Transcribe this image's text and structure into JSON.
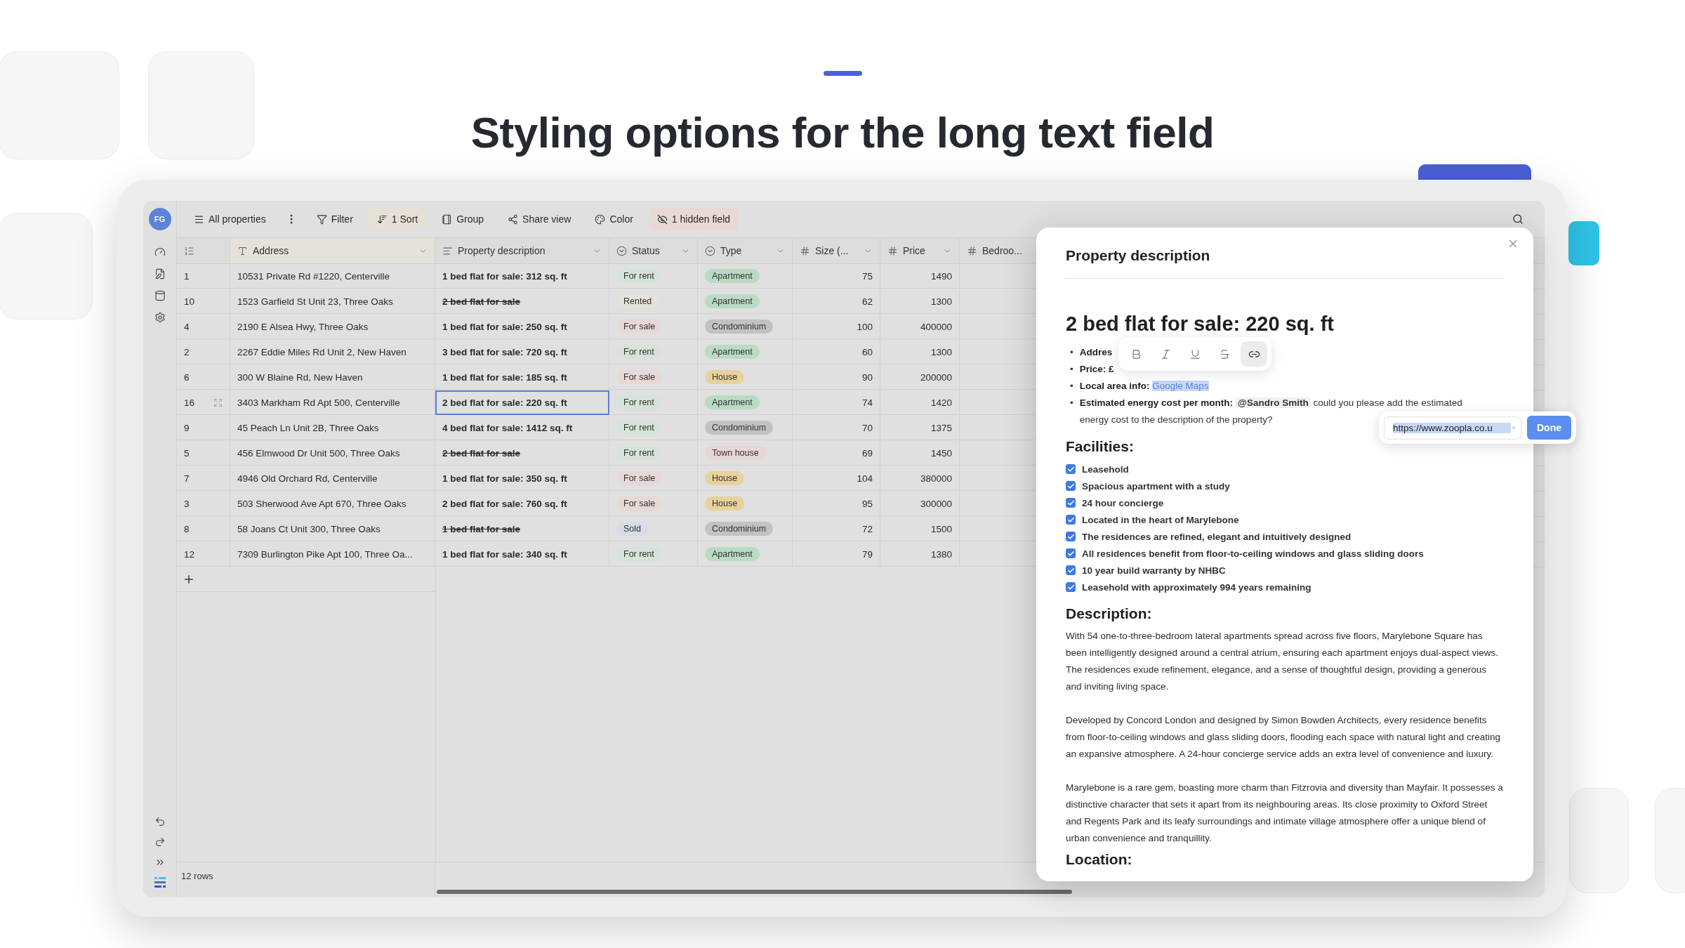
{
  "heading": "Styling options for the long text field",
  "app": {
    "avatar": "FG",
    "toolbar": [
      {
        "kind": "view",
        "label": "All properties"
      },
      {
        "kind": "more"
      },
      {
        "kind": "filter",
        "label": "Filter"
      },
      {
        "kind": "sort",
        "label": "1 Sort",
        "color": "#e6e1d6"
      },
      {
        "kind": "group",
        "label": "Group"
      },
      {
        "kind": "share",
        "label": "Share view"
      },
      {
        "kind": "color",
        "label": "Color"
      },
      {
        "kind": "hidden",
        "label": "1 hidden field",
        "color": "#e8d9d7"
      }
    ],
    "columns": [
      {
        "kind": "text",
        "label": "Address"
      },
      {
        "kind": "longtext",
        "label": "Property description"
      },
      {
        "kind": "select",
        "label": "Status"
      },
      {
        "kind": "select",
        "label": "Type"
      },
      {
        "kind": "number",
        "label": "Size (..."
      },
      {
        "kind": "number",
        "label": "Price"
      },
      {
        "kind": "number",
        "label": "Bedroo..."
      }
    ],
    "rows": [
      {
        "id": "1",
        "address": "10531 Private Rd #1220, Centerville",
        "description": "1 bed flat for sale: 312 sq. ft",
        "strikethrough": false,
        "status": {
          "label": "For rent",
          "color": "#d5e3d9"
        },
        "type": {
          "label": "Apartment",
          "color": "#b9dbc3"
        },
        "size": "75",
        "price": "1490",
        "selected": false
      },
      {
        "id": "10",
        "address": "1523 Garfield St Unit 23, Three Oaks",
        "description": "2 bed flat for sale",
        "strikethrough": true,
        "status": {
          "label": "Rented",
          "color": "#e6e2da"
        },
        "type": {
          "label": "Apartment",
          "color": "#b9dbc3"
        },
        "size": "62",
        "price": "1300",
        "selected": false
      },
      {
        "id": "4",
        "address": "2190 E Alsea Hwy, Three Oaks",
        "description": "1 bed flat for sale: 250 sq. ft",
        "strikethrough": false,
        "status": {
          "label": "For sale",
          "color": "#e8d8d8"
        },
        "type": {
          "label": "Condominium",
          "color": "#c2c2c4"
        },
        "size": "100",
        "price": "400000",
        "selected": false
      },
      {
        "id": "2",
        "address": "2267 Eddie Miles Rd Unit 2, New Haven",
        "description": "3 bed flat for sale: 720 sq. ft",
        "strikethrough": false,
        "status": {
          "label": "For rent",
          "color": "#d5e3d9"
        },
        "type": {
          "label": "Apartment",
          "color": "#b9dbc3"
        },
        "size": "60",
        "price": "1300",
        "selected": false
      },
      {
        "id": "6",
        "address": "300 W Blaine Rd, New Haven",
        "description": "1 bed flat for sale: 185 sq. ft",
        "strikethrough": false,
        "status": {
          "label": "For sale",
          "color": "#e8d8d8"
        },
        "type": {
          "label": "House",
          "color": "#e8d29c"
        },
        "size": "90",
        "price": "200000",
        "selected": false
      },
      {
        "id": "16",
        "address": "3403 Markham Rd Apt 500, Centerville",
        "description": "2 bed flat for sale: 220 sq. ft",
        "strikethrough": false,
        "status": {
          "label": "For rent",
          "color": "#d5e3d9"
        },
        "type": {
          "label": "Apartment",
          "color": "#b9dbc3"
        },
        "size": "74",
        "price": "1420",
        "selected": true
      },
      {
        "id": "9",
        "address": "45 Peach Ln Unit 2B, Three Oaks",
        "description": "4 bed flat for sale: 1412 sq. ft",
        "strikethrough": false,
        "status": {
          "label": "For rent",
          "color": "#d5e3d9"
        },
        "type": {
          "label": "Condominium",
          "color": "#c2c2c4"
        },
        "size": "70",
        "price": "1375",
        "selected": false
      },
      {
        "id": "5",
        "address": "456 Elmwood Dr Unit 500, Three Oaks",
        "description": "2 bed flat for sale",
        "strikethrough": true,
        "status": {
          "label": "For rent",
          "color": "#d5e3d9"
        },
        "type": {
          "label": "Town house",
          "color": "#e8d6d6"
        },
        "size": "69",
        "price": "1450",
        "selected": false
      },
      {
        "id": "7",
        "address": "4946 Old Orchard Rd, Centerville",
        "description": "1 bed flat for sale: 350 sq. ft",
        "strikethrough": false,
        "status": {
          "label": "For sale",
          "color": "#e8d8d8"
        },
        "type": {
          "label": "House",
          "color": "#e8d29c"
        },
        "size": "104",
        "price": "380000",
        "selected": false
      },
      {
        "id": "3",
        "address": "503 Sherwood Ave Apt 670, Three Oaks",
        "description": "2 bed flat for sale: 760 sq. ft",
        "strikethrough": false,
        "status": {
          "label": "For sale",
          "color": "#e8d8d8"
        },
        "type": {
          "label": "House",
          "color": "#e8d29c"
        },
        "size": "95",
        "price": "300000",
        "selected": false
      },
      {
        "id": "8",
        "address": "58 Joans Ct Unit 300, Three Oaks",
        "description": "1 bed flat for sale",
        "strikethrough": true,
        "status": {
          "label": "Sold",
          "color": "#d8dce8"
        },
        "type": {
          "label": "Condominium",
          "color": "#c2c2c4"
        },
        "size": "72",
        "price": "1500",
        "selected": false
      },
      {
        "id": "12",
        "address": "7309 Burlington Pike Apt 100, Three Oa...",
        "description": "1 bed flat for sale: 340 sq. ft",
        "strikethrough": false,
        "status": {
          "label": "For rent",
          "color": "#d5e3d9"
        },
        "type": {
          "label": "Apartment",
          "color": "#b9dbc3"
        },
        "size": "79",
        "price": "1380",
        "selected": false
      }
    ],
    "row_count": "12 rows"
  },
  "editor": {
    "title": "Property description",
    "heading": "2 bed flat for sale: 220 sq. ft",
    "bullets": [
      {
        "marker": "•",
        "label": "Addres"
      },
      {
        "marker": "•",
        "label": "Price: £"
      },
      {
        "marker": "•",
        "label": "Local area info:",
        "link": {
          "label": "Google Maps",
          "selected": true
        }
      },
      {
        "marker": "•",
        "label": "Estimated energy cost per month:",
        "mention": "@Sandro Smith",
        "text": "could you please add the estimated energy cost to the description of the property?"
      }
    ],
    "format_toolbar": [
      {
        "kind": "bold",
        "active": false
      },
      {
        "kind": "italic",
        "active": false
      },
      {
        "kind": "underline",
        "active": false
      },
      {
        "kind": "strike",
        "active": false
      },
      {
        "kind": "link",
        "active": true
      }
    ],
    "link_popup": {
      "value": "https://www.zoopla.co.u",
      "button": "Done"
    },
    "facilities_heading": "Facilities:",
    "facilities": [
      {
        "label": "Leasehold",
        "checked": true
      },
      {
        "label": "Spacious apartment with a study",
        "checked": true
      },
      {
        "label": "24 hour concierge",
        "checked": true
      },
      {
        "label": "Located in the heart of Marylebone",
        "checked": true
      },
      {
        "label": "The residences are refined, elegant and intuitively designed",
        "checked": true
      },
      {
        "label": "All residences benefit from floor-to-ceiling windows and glass sliding doors",
        "checked": true
      },
      {
        "label": "10 year build warranty by NHBC",
        "checked": true
      },
      {
        "label": "Leasehold with approximately 994 years remaining",
        "checked": true
      }
    ],
    "description_heading": "Description:",
    "paragraphs": [
      "With 54 one-to-three-bedroom lateral apartments spread across five floors, Marylebone Square has been intelligently designed around a central atrium, ensuring each apartment enjoys dual-aspect views. The residences exude refinement, elegance, and a sense of thoughtful design, providing a generous and inviting living space.",
      "Developed by Concord London and designed by Simon Bowden Architects, every residence benefits from floor-to-ceiling windows and glass sliding doors, flooding each space with natural light and creating an expansive atmosphere. A 24-hour concierge service adds an extra level of convenience and luxury.",
      "Marylebone is a rare gem, boasting more charm than Fitzrovia and diversity than Mayfair. It possesses a distinctive character that sets it apart from its neighbouring areas. Its close proximity to Oxford Street and Regents Park and its leafy surroundings and intimate village atmosphere offer a unique blend of urban convenience and tranquillity."
    ],
    "location_heading": "Location:"
  }
}
